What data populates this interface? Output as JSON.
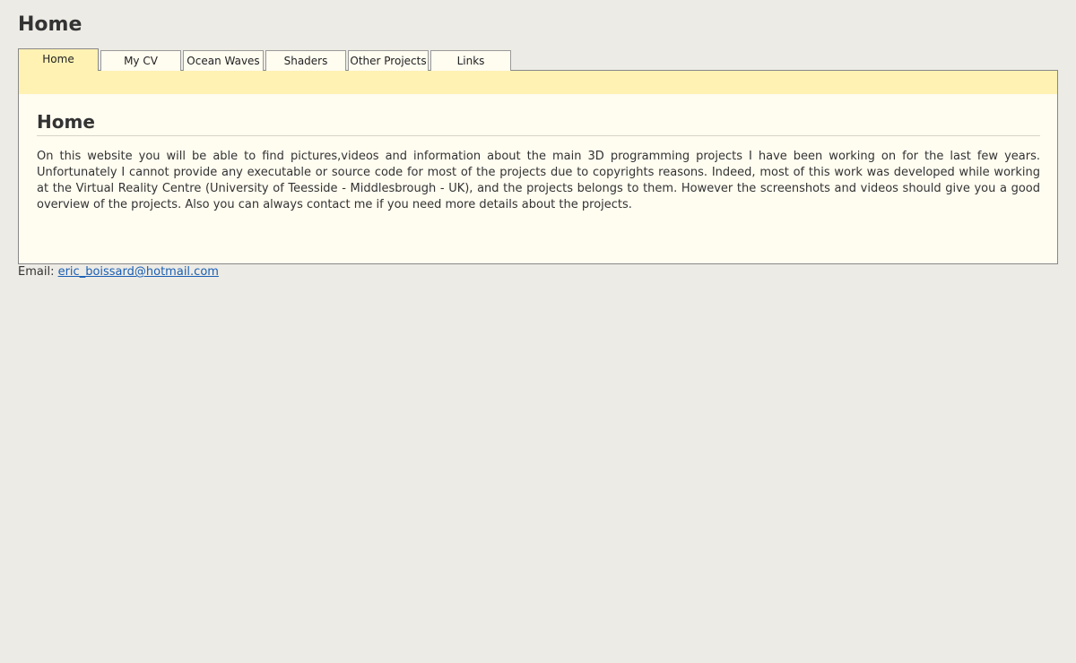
{
  "header": {
    "title": "Home"
  },
  "tabs": [
    {
      "label": "Home",
      "active": true
    },
    {
      "label": "My CV",
      "active": false
    },
    {
      "label": "Ocean Waves",
      "active": false
    },
    {
      "label": "Shaders",
      "active": false
    },
    {
      "label": "Other Projects",
      "active": false
    },
    {
      "label": "Links",
      "active": false
    }
  ],
  "main": {
    "heading": "Home",
    "body": "On this website you will be able to find pictures,videos and information about the main 3D programming projects I have been working on for the last few years. Unfortunately I cannot provide any executable or source code for most of the projects due to copyrights reasons. Indeed, most of this work was developed while working at the Virtual Reality Centre (University of Teesside - Middlesbrough - UK), and the projects belongs to them. However the screenshots and videos should give you a good overview of the projects. Also you can always contact me if you need more details about the projects."
  },
  "footer": {
    "email_label": "Email: ",
    "email_address": "eric_boissard@hotmail.com"
  },
  "colors": {
    "background": "#edebe5",
    "panel": "#fffcf0",
    "active_tab": "#fff2b3",
    "link": "#1a5fb4"
  }
}
